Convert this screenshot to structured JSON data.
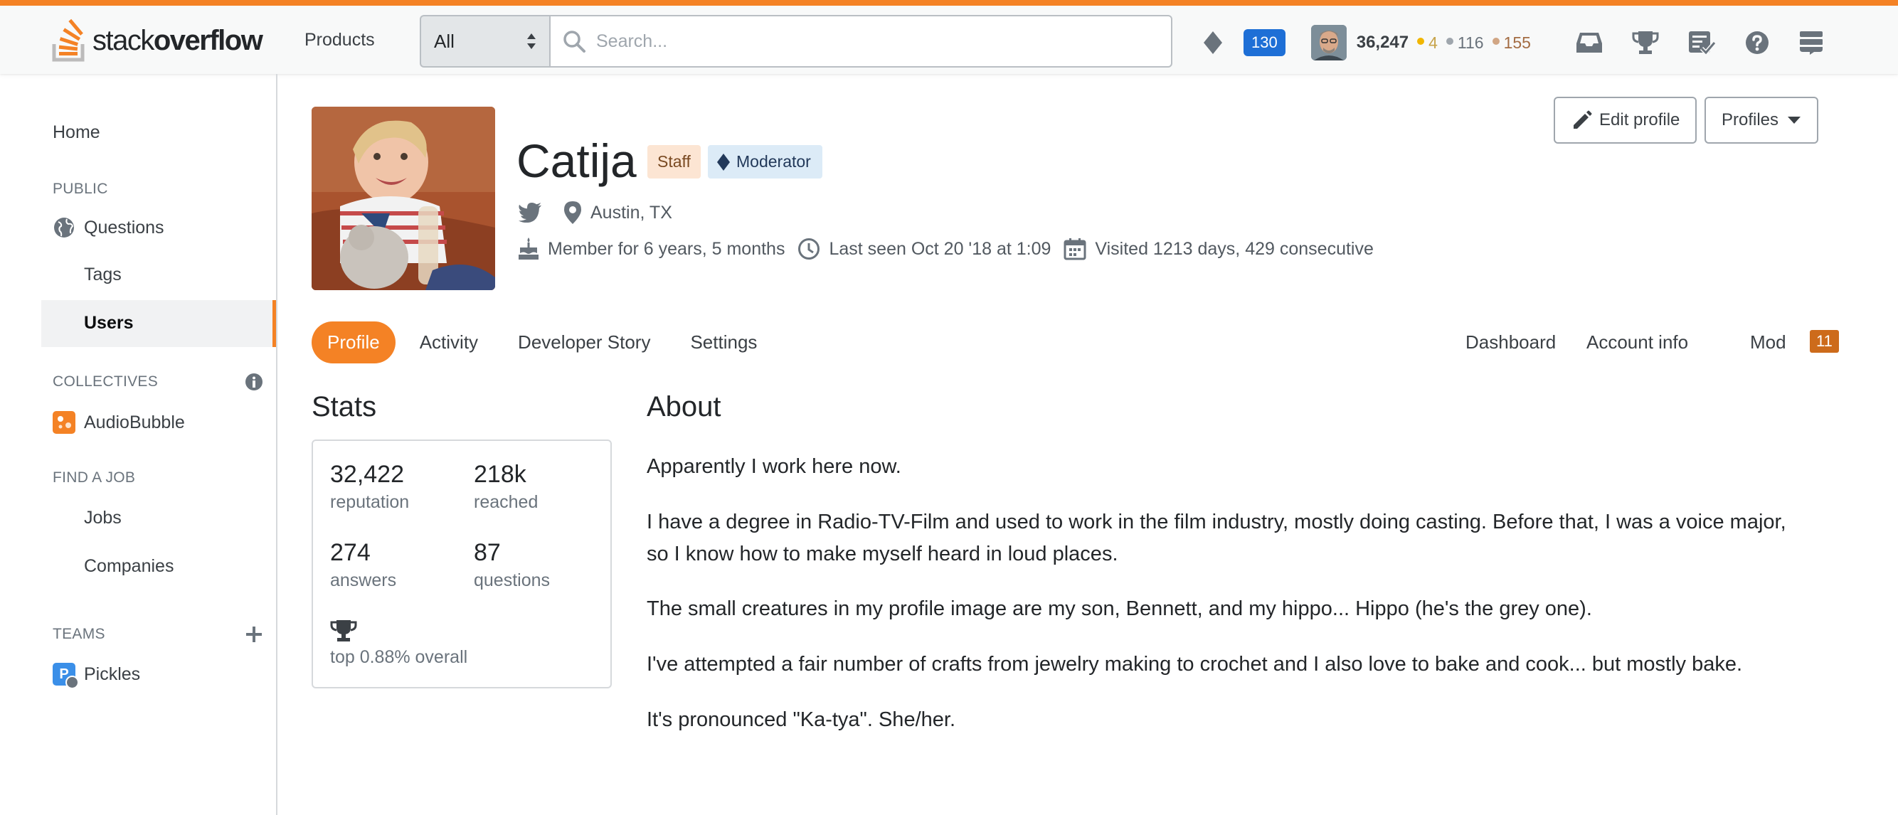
{
  "header": {
    "logo_text_light": "stack",
    "logo_text_bold": "overflow",
    "products_label": "Products",
    "search_scope": "All",
    "search_placeholder": "Search...",
    "mod_count": "130",
    "reputation": "36,247",
    "badges": {
      "gold": "4",
      "silver": "116",
      "bronze": "155"
    },
    "colors": {
      "accent": "#f48225",
      "gold": "#f1b600",
      "silver": "#9fa6ad",
      "bronze": "#d1a684",
      "mod_blue": "#1e6fd6"
    }
  },
  "sidebar": {
    "home": "Home",
    "public_heading": "PUBLIC",
    "questions": "Questions",
    "tags": "Tags",
    "users": "Users",
    "collectives_heading": "COLLECTIVES",
    "collective": "AudioBubble",
    "find_job_heading": "FIND A JOB",
    "jobs": "Jobs",
    "companies": "Companies",
    "teams_heading": "TEAMS",
    "team": "Pickles",
    "team_letter": "P"
  },
  "profile": {
    "name": "Catija",
    "staff_badge": "Staff",
    "moderator_badge": "Moderator",
    "location": "Austin, TX",
    "member_for": "Member for 6 years, 5 months",
    "last_seen": "Last seen Oct 20 '18 at 1:09",
    "visited": "Visited 1213 days, 429 consecutive",
    "edit_profile": "Edit profile",
    "profiles": "Profiles"
  },
  "tabs": {
    "left": [
      "Profile",
      "Activity",
      "Developer Story",
      "Settings"
    ],
    "dashboard": "Dashboard",
    "account_info": "Account info",
    "mod": "Mod",
    "mod_count": "11"
  },
  "stats": {
    "title": "Stats",
    "reputation_value": "32,422",
    "reputation_label": "reputation",
    "reached_value": "218k",
    "reached_label": "reached",
    "answers_value": "274",
    "answers_label": "answers",
    "questions_value": "87",
    "questions_label": "questions",
    "rank_text": "top 0.88% overall"
  },
  "about": {
    "title": "About",
    "paragraphs": [
      "Apparently I work here now.",
      "I have a degree in Radio-TV-Film and used to work in the film industry, mostly doing casting. Before that, I was a voice major, so I know how to make myself heard in loud places.",
      "The small creatures in my profile image are my son, Bennett, and my hippo... Hippo (he's the grey one).",
      "I've attempted a fair number of crafts from jewelry making to crochet and I also love to bake and cook... but mostly bake.",
      "It's pronounced \"Ka-tya\". She/her."
    ]
  }
}
